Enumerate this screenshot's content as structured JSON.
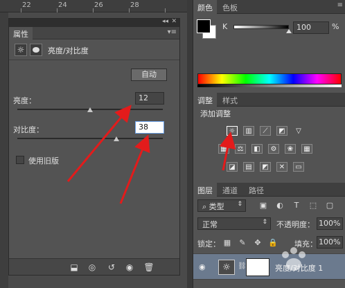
{
  "ruler": {
    "marks": [
      "22",
      "24",
      "26",
      "28"
    ]
  },
  "properties": {
    "tab_label": "属性",
    "title": "亮度/对比度",
    "auto_label": "自动",
    "brightness_label": "亮度：",
    "brightness_value": "12",
    "brightness_fraction": 0.5,
    "contrast_label": "对比度：",
    "contrast_value": "38",
    "contrast_fraction": 0.68,
    "legacy_label": "使用旧版"
  },
  "color_panel": {
    "tabs": [
      "颜色",
      "色板"
    ],
    "channel_label": "K",
    "channel_value": "100",
    "channel_unit": "%"
  },
  "adjustments_panel": {
    "tabs": [
      "调整",
      "样式"
    ],
    "title": "添加调整"
  },
  "layers_panel": {
    "tabs": [
      "图层",
      "通道",
      "路径"
    ],
    "filter_label": "类型",
    "blend_mode": "正常",
    "opacity_label": "不透明度：",
    "opacity_value": "100%",
    "lock_label": "锁定：",
    "fill_label": "填充：",
    "fill_value": "100%",
    "layer_name": "亮度/对比度 1"
  },
  "colors": {
    "annotation_arrow": "#e31b1b",
    "accent_focus": "#6aa0e8"
  }
}
